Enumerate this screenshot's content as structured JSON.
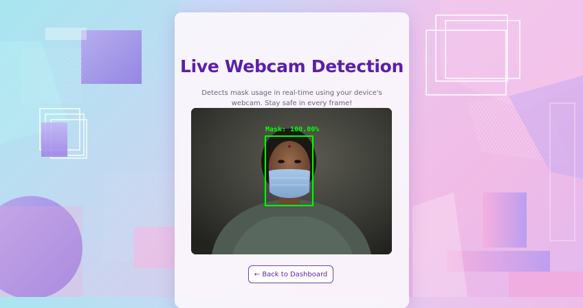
{
  "page": {
    "title": "Live Webcam Detection",
    "subtitle": "Detects mask usage in real-time using your device's webcam. Stay safe in every frame!"
  },
  "webcam": {
    "detection_label": "Mask: 100.00%",
    "detection_color": "#00ff00"
  },
  "actions": {
    "back_icon": "←",
    "back_label": "Back to Dashboard"
  },
  "colors": {
    "title": "#5b1fa8",
    "accent": "#6a3fb8"
  }
}
